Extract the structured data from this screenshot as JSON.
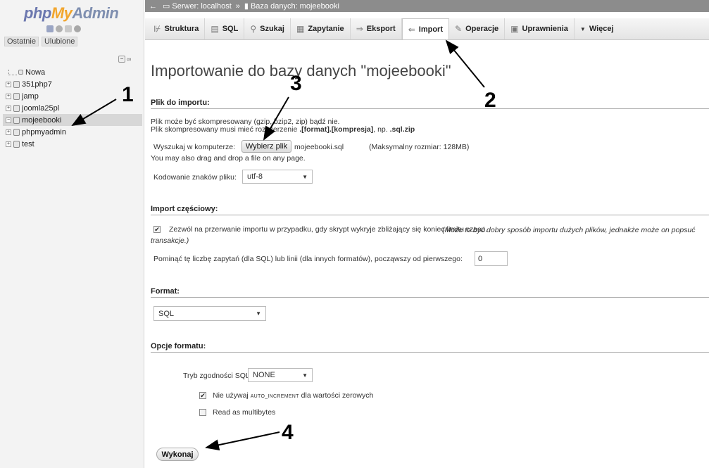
{
  "nav": {
    "logo_php": "php",
    "logo_my": "My",
    "logo_admin": "Admin",
    "links": [
      "Ostatnie",
      "Ulubione"
    ],
    "new_item": "Nowa",
    "databases": [
      "351php7",
      "jamp",
      "joomla25pl",
      "mojeebooki",
      "phpmyadmin",
      "test"
    ],
    "selected": "mojeebooki"
  },
  "breadcrumb": {
    "server": "Serwer: localhost",
    "database": "Baza danych: mojeebooki"
  },
  "tabs": [
    {
      "label": "Struktura",
      "icon": "structure-icon",
      "glyph": "⊮"
    },
    {
      "label": "SQL",
      "icon": "sql-icon",
      "glyph": "▤"
    },
    {
      "label": "Szukaj",
      "icon": "search-icon",
      "glyph": "⚲"
    },
    {
      "label": "Zapytanie",
      "icon": "query-icon",
      "glyph": "▦"
    },
    {
      "label": "Eksport",
      "icon": "export-icon",
      "glyph": "⇒"
    },
    {
      "label": "Import",
      "icon": "import-icon",
      "glyph": "⇐"
    },
    {
      "label": "Operacje",
      "icon": "wrench-icon",
      "glyph": "✎"
    },
    {
      "label": "Uprawnienia",
      "icon": "privileges-icon",
      "glyph": "▣"
    },
    {
      "label": "Więcej",
      "icon": "chevron-down-icon",
      "glyph": "▼"
    }
  ],
  "active_tab": "Import",
  "page": {
    "title": "Importowanie do bazy danych \"mojeebooki\"",
    "file_section": {
      "heading": "Plik do importu:",
      "line1": "Plik może być skompresowany (gzip, bzip2, zip) bądź nie.",
      "line2_pre": "Plik skompresowany musi mieć rozszerzenie ",
      "line2_fmt": ".[format].[kompresja]",
      "line2_mid": ", np. ",
      "line2_ex": ".sql.zip",
      "browse_label": "Wyszukaj w komputerze:",
      "browse_button": "Wybierz plik",
      "chosen_file": "mojeebooki.sql",
      "max_size": "(Maksymalny rozmiar: 128MB)",
      "drag_hint": "You may also drag and drop a file on any page.",
      "charset_label": "Kodowanie znaków pliku:",
      "charset_value": "utf-8"
    },
    "partial_section": {
      "heading": "Import częściowy:",
      "allow_interrupt": "Zezwól na przerwanie importu w przypadku, gdy skrypt wykryje zbliżający się koniec limitu czasu.",
      "allow_interrupt_note": "(Może to być dobry sposób importu dużych plików, jednakże może on popsuć transakcje.)",
      "allow_interrupt_checked": true,
      "skip_label": "Pominąć tę liczbę zapytań (dla SQL) lub linii (dla innych formatów), począwszy od pierwszego:",
      "skip_value": "0"
    },
    "format_section": {
      "heading": "Format:",
      "value": "SQL"
    },
    "options_section": {
      "heading": "Opcje formatu:",
      "compat_label": "Tryb zgodności SQL:",
      "compat_value": "NONE",
      "no_auto_pre": "Nie używaj",
      "no_auto_code": "AUTO_INCREMENT",
      "no_auto_post": "dla wartości zerowych",
      "no_auto_checked": true,
      "multibytes": "Read as multibytes",
      "multibytes_checked": false
    },
    "submit": "Wykonaj"
  },
  "annotations": [
    "1",
    "2",
    "3",
    "4"
  ]
}
